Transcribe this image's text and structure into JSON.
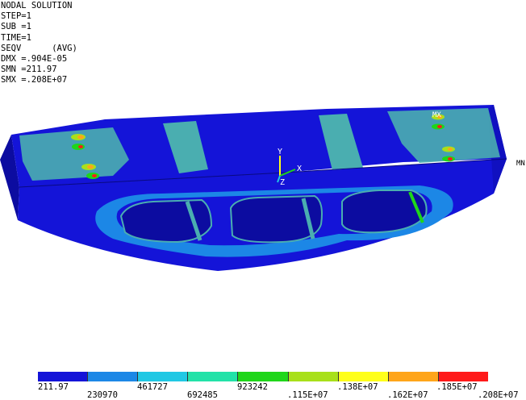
{
  "header": {
    "lines": [
      "NODAL SOLUTION",
      "STEP=1",
      "SUB =1",
      "TIME=1",
      "SEQV      (AVG)",
      "DMX =.904E-05",
      "SMN =211.97",
      "SMX =.208E+07"
    ]
  },
  "triad": {
    "y_label": "Y",
    "z_label": "Z",
    "x_label": "X"
  },
  "markers": {
    "mn": "MN",
    "mx": "MX"
  },
  "legend": {
    "colors": [
      "#1414d8",
      "#1c87e6",
      "#20c8e4",
      "#22e2a8",
      "#1fd61a",
      "#a8e01a",
      "#ffff1a",
      "#ffa51a",
      "#ff1a1a"
    ],
    "top_labels": [
      "211.97",
      "461727",
      "923242",
      ".138E+07",
      ".185E+07"
    ],
    "bottom_labels": [
      "230970",
      "692485",
      ".115E+07",
      ".162E+07",
      ".208E+07"
    ]
  },
  "fill_colors": {
    "blue": "#1414d8",
    "dark_blue": "#0c0ca0",
    "light_blue": "#1c87e6",
    "cyan": "#20c8e4",
    "teal": "#4aaeb0",
    "green": "#1fd61a",
    "yellow": "#ffff1a",
    "orange": "#ffa51a",
    "red": "#ff1a1a"
  }
}
